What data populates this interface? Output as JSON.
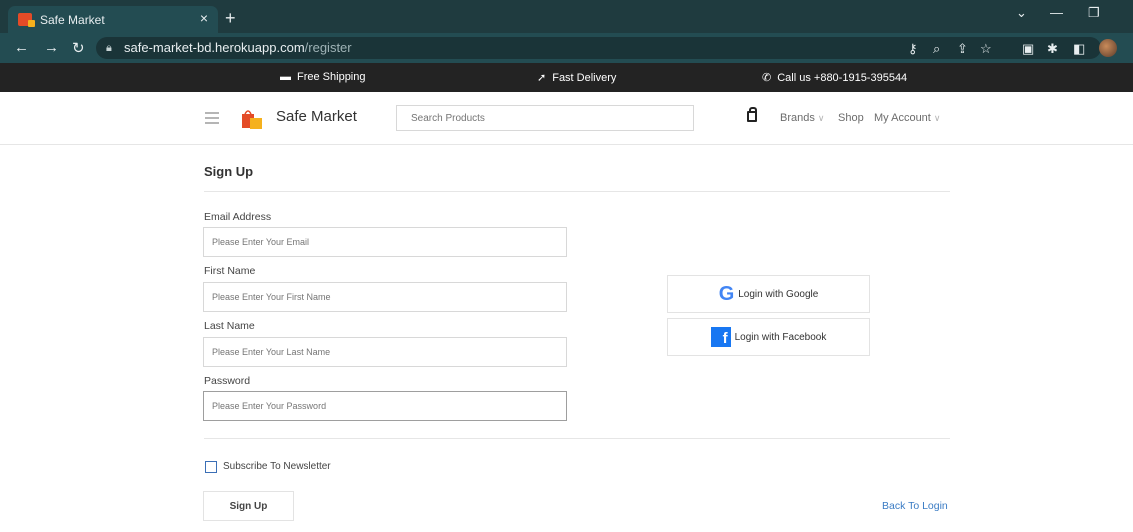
{
  "browser": {
    "tab_title": "Safe Market",
    "tab_close": "×",
    "new_tab": "+",
    "url_host": "safe-market-bd.herokuapp.com",
    "url_path": "/register"
  },
  "strip": {
    "shipping": "Free Shipping",
    "delivery": "Fast Delivery",
    "call": "Call us +880-1915-395544"
  },
  "header": {
    "brand": "Safe Market",
    "search_placeholder": "Search Products",
    "nav": [
      "Brands",
      "Shop",
      "My Account"
    ]
  },
  "form": {
    "title": "Sign Up",
    "email_label": "Email Address",
    "email_placeholder": "Please Enter Your Email",
    "first_label": "First Name",
    "first_placeholder": "Please Enter Your First Name",
    "last_label": "Last Name",
    "last_placeholder": "Please Enter Your Last Name",
    "password_label": "Password",
    "password_placeholder": "Please Enter Your Password",
    "newsletter": "Subscribe To Newsletter",
    "submit": "Sign Up",
    "back": "Back To Login"
  },
  "social": {
    "google": "Login with Google",
    "facebook": "Login with Facebook"
  },
  "colors": {
    "accent_link": "#3b7cc4",
    "chrome": "#1f3b3f",
    "strip": "#232323"
  }
}
